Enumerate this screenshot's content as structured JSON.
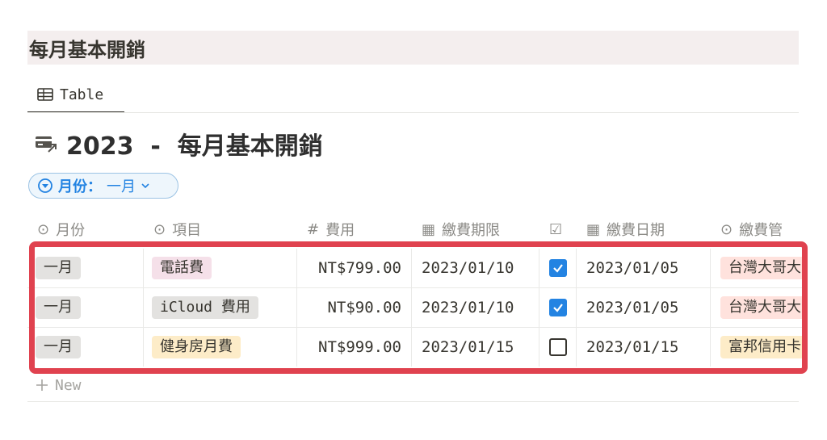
{
  "page": {
    "title": "每月基本開銷"
  },
  "view_tab": {
    "icon": "table-icon",
    "label": "Table"
  },
  "database": {
    "icon": "card-export-icon",
    "title": "2023  -  每月基本開銷"
  },
  "filter": {
    "icon": "select-circle-icon",
    "label": "月份：",
    "value": "一月",
    "chevron": "chevron-down-icon"
  },
  "columns": [
    {
      "icon": "⊙",
      "icon_name": "select-icon",
      "label": "月份"
    },
    {
      "icon": "⊙",
      "icon_name": "select-icon",
      "label": "項目"
    },
    {
      "icon": "#",
      "icon_name": "number-icon",
      "label": "費用"
    },
    {
      "icon": "▦",
      "icon_name": "calendar-icon",
      "label": "繳費期限"
    },
    {
      "icon": "☑",
      "icon_name": "checkbox-icon",
      "label": ""
    },
    {
      "icon": "▦",
      "icon_name": "calendar-icon",
      "label": "繳費日期"
    },
    {
      "icon": "⊙",
      "icon_name": "select-icon",
      "label": "繳費管"
    }
  ],
  "rows": [
    {
      "month": "一月",
      "item": "電話費",
      "item_color": "pink",
      "cost": "NT$799.00",
      "due": "2023/01/10",
      "paid": true,
      "paid_date": "2023/01/05",
      "method": "台灣大哥大",
      "method_color": "red"
    },
    {
      "month": "一月",
      "item": "iCloud 費用",
      "item_color": "gray",
      "cost": "NT$90.00",
      "due": "2023/01/10",
      "paid": true,
      "paid_date": "2023/01/05",
      "method": "台灣大哥大",
      "method_color": "red"
    },
    {
      "month": "一月",
      "item": "健身房月費",
      "item_color": "yellow",
      "cost": "NT$999.00",
      "due": "2023/01/15",
      "paid": false,
      "paid_date": "2023/01/15",
      "method": "富邦信用卡",
      "method_color": "yellow"
    }
  ],
  "new_row": {
    "label": "New"
  },
  "colors": {
    "accent": "#2383e2",
    "highlight": "#e0424f"
  }
}
